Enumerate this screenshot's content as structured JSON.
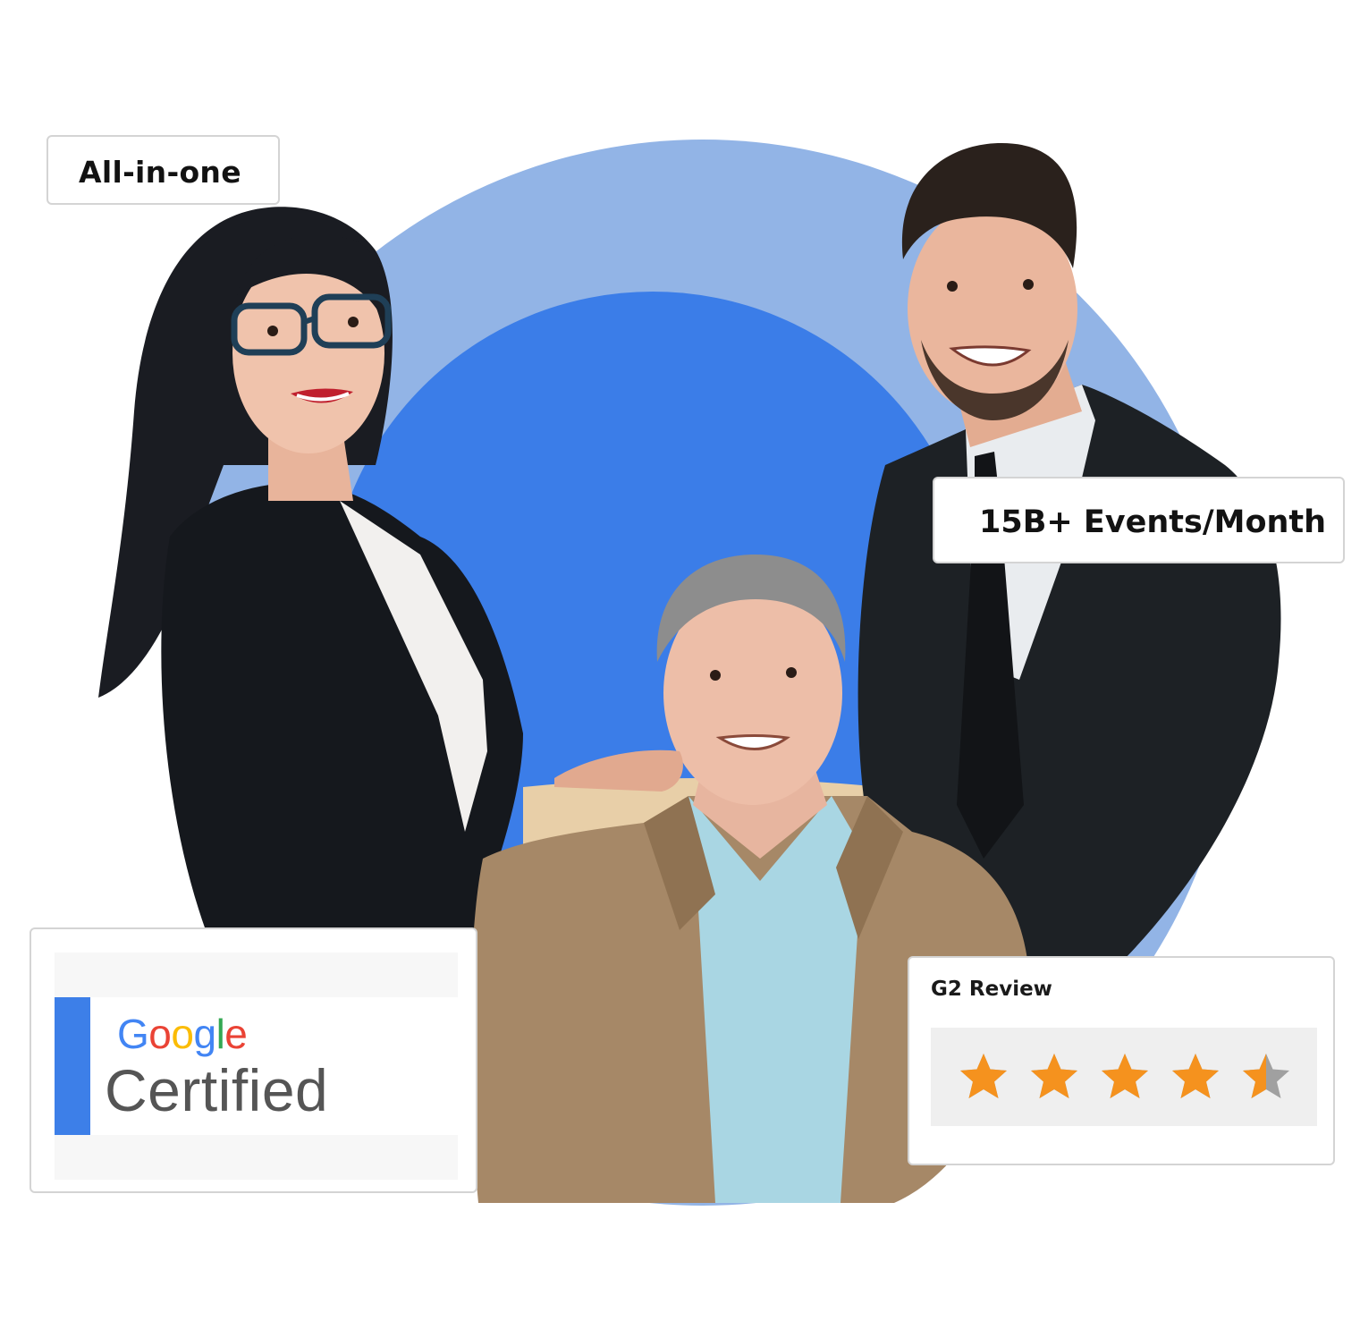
{
  "badges": {
    "all_in_one": "All-in-one",
    "events": "15B+ Events/Month"
  },
  "google_card": {
    "logo_letters": [
      {
        "ch": "G",
        "color": "#4285F4"
      },
      {
        "ch": "o",
        "color": "#EA4335"
      },
      {
        "ch": "o",
        "color": "#FBBC05"
      },
      {
        "ch": "g",
        "color": "#4285F4"
      },
      {
        "ch": "l",
        "color": "#34A853"
      },
      {
        "ch": "e",
        "color": "#EA4335"
      }
    ],
    "logo_text": "Google",
    "certified_text": "Certified",
    "accent_color": "#3d7fe8"
  },
  "g2_card": {
    "title": "G2 Review",
    "rating": 4.5,
    "max_rating": 5,
    "star_color": "#f5921e",
    "empty_star_color": "#a0a0a0"
  },
  "colors": {
    "circle_outer": "#92b4e6",
    "circle_inner": "#3b7de8"
  },
  "illustration": {
    "subject": "three-business-people-photo"
  }
}
